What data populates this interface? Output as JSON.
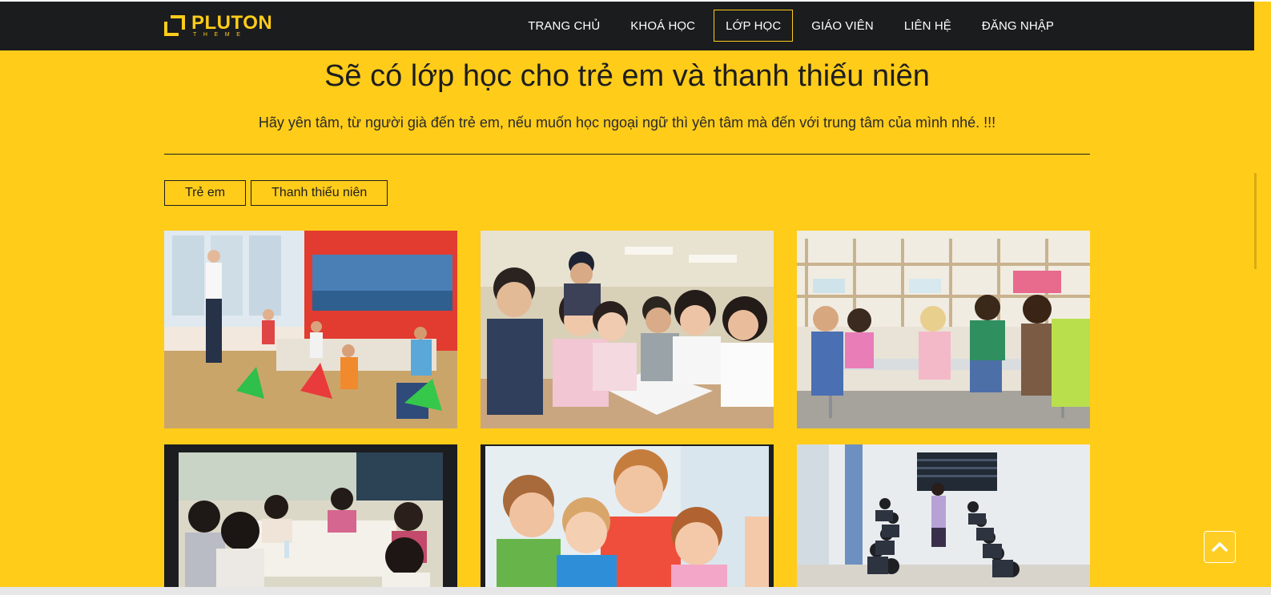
{
  "brand": {
    "name": "PLUTON",
    "tagline": "THEME",
    "accent_color": "#ffcc1a",
    "nav_color": "#1b1c1e"
  },
  "nav": {
    "items": [
      {
        "label": "TRANG CHỦ"
      },
      {
        "label": "KHOÁ HỌC"
      },
      {
        "label": "LỚP HỌC",
        "active": true
      },
      {
        "label": "GIÁO VIÊN"
      },
      {
        "label": "LIÊN HỆ"
      },
      {
        "label": "ĐĂNG NHẬP"
      }
    ]
  },
  "section": {
    "title": "Sẽ có lớp học cho trẻ em và thanh thiếu niên",
    "subtitle": "Hãy yên tâm, từ người già đến trẻ em, nếu muốn học ngoại ngữ thì yên tâm mà đến với trung tâm của mình nhé. !!!"
  },
  "filters": [
    {
      "label": "Trẻ em"
    },
    {
      "label": "Thanh thiếu niên"
    }
  ],
  "gallery": {
    "photos": [
      {
        "name": "kids-classroom-teacher-photo"
      },
      {
        "name": "teens-studying-group-photo"
      },
      {
        "name": "kids-drawing-table-photo"
      },
      {
        "name": "teens-classroom-table-photo"
      },
      {
        "name": "smiling-kids-photo"
      },
      {
        "name": "small-classroom-photo"
      }
    ]
  },
  "icons": {
    "logo": "square-bracket-logo-icon",
    "scroll_top": "chevron-up-icon"
  }
}
